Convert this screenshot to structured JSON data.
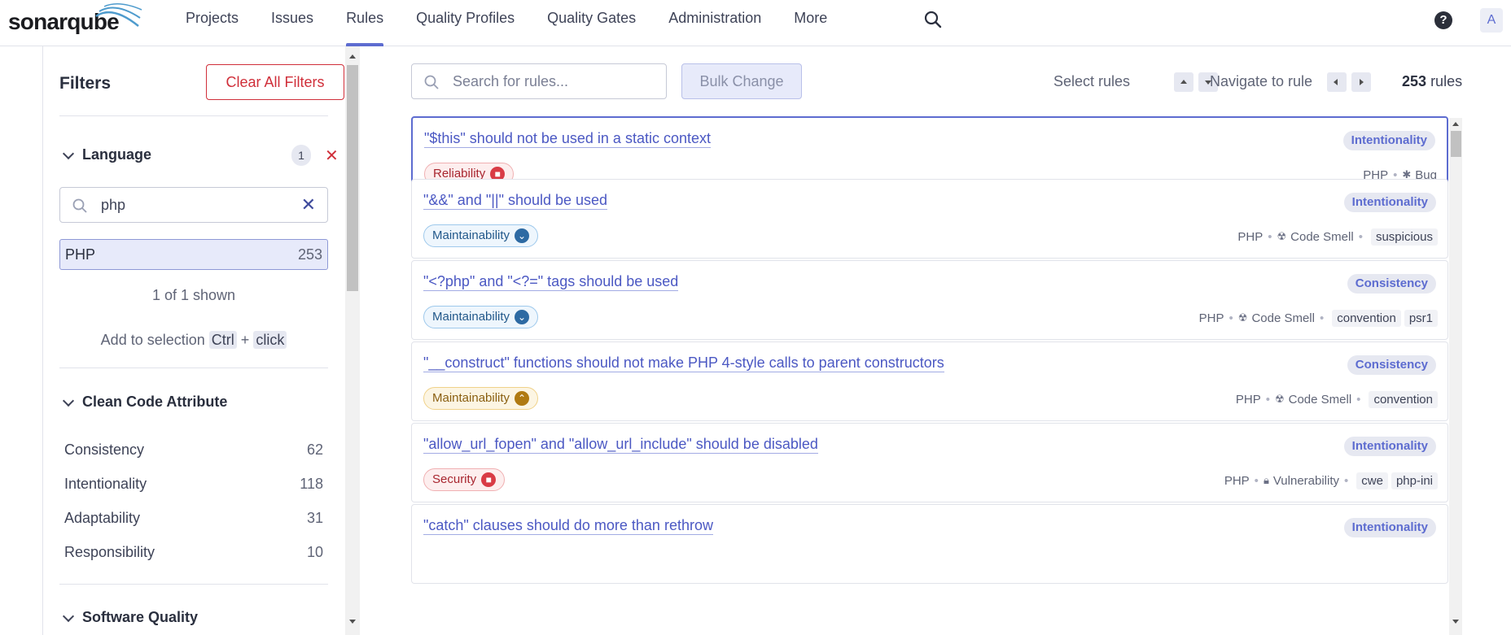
{
  "app": {
    "logo": "sonarqube"
  },
  "nav": {
    "items": [
      {
        "label": "Projects"
      },
      {
        "label": "Issues"
      },
      {
        "label": "Rules"
      },
      {
        "label": "Quality Profiles"
      },
      {
        "label": "Quality Gates"
      },
      {
        "label": "Administration"
      },
      {
        "label": "More"
      }
    ],
    "active": "Rules",
    "help": "?",
    "avatar": "A"
  },
  "sidebar": {
    "title": "Filters",
    "clear_all": "Clear All Filters",
    "language": {
      "label": "Language",
      "selected_count": "1",
      "search_value": "php",
      "options": [
        {
          "label": "PHP",
          "count": "253"
        }
      ],
      "shown": "1 of 1 shown",
      "hint_prefix": "Add to selection",
      "hint_key": "Ctrl",
      "hint_plus": "+",
      "hint_action": "click"
    },
    "clean_code": {
      "label": "Clean Code Attribute",
      "items": [
        {
          "label": "Consistency",
          "count": "62"
        },
        {
          "label": "Intentionality",
          "count": "118"
        },
        {
          "label": "Adaptability",
          "count": "31"
        },
        {
          "label": "Responsibility",
          "count": "10"
        }
      ]
    },
    "software_quality": {
      "label": "Software Quality"
    }
  },
  "toolbar": {
    "search_placeholder": "Search for rules...",
    "bulk_change": "Bulk Change",
    "select_rules": "Select rules",
    "navigate": "Navigate to rule",
    "count": "253",
    "count_suffix": "rules"
  },
  "rules": [
    {
      "title": "\"$this\" should not be used in a static context",
      "attribute": "Intentionality",
      "quality": "Reliability",
      "language": "PHP",
      "type": "Bug",
      "tags": []
    },
    {
      "title": "\"&&\" and \"||\" should be used",
      "attribute": "Intentionality",
      "quality": "Maintainability",
      "language": "PHP",
      "type": "Code Smell",
      "tags": [
        "suspicious"
      ]
    },
    {
      "title": "\"<?php\" and \"<?=\" tags should be used",
      "attribute": "Consistency",
      "quality": "Maintainability",
      "language": "PHP",
      "type": "Code Smell",
      "tags": [
        "convention",
        "psr1"
      ]
    },
    {
      "title": "\"__construct\" functions should not make PHP 4-style calls to parent constructors",
      "attribute": "Consistency",
      "quality": "Maintainability",
      "language": "PHP",
      "type": "Code Smell",
      "tags": [
        "convention"
      ]
    },
    {
      "title": "\"allow_url_fopen\" and \"allow_url_include\" should be disabled",
      "attribute": "Intentionality",
      "quality": "Security",
      "language": "PHP",
      "type": "Vulnerability",
      "tags": [
        "cwe",
        "php-ini"
      ]
    },
    {
      "title": "\"catch\" clauses should do more than rethrow",
      "attribute": "Intentionality"
    }
  ],
  "colors": {
    "accent": "#5d6cd0",
    "danger": "#d02f3a",
    "selection": "#e7eafa"
  }
}
